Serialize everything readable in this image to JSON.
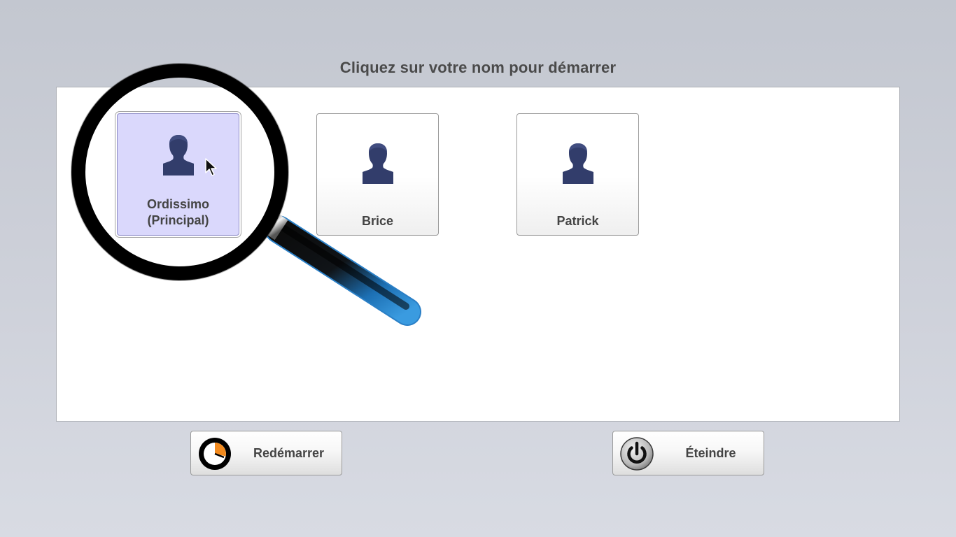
{
  "header": {
    "title": "Cliquez sur votre nom pour démarrer"
  },
  "users": [
    {
      "name_line1": "Ordissimo",
      "name_line2": "(Principal)",
      "selected": true
    },
    {
      "name": "Brice",
      "selected": false
    },
    {
      "name": "Patrick",
      "selected": false
    }
  ],
  "footer": {
    "restart_label": "Redémarrer",
    "shutdown_label": "Éteindre"
  },
  "colors": {
    "selected_card": "#dad8fc",
    "avatar": "#323d6b",
    "magnifier_handle": "#1c72b8",
    "restart_accent": "#f28a1e"
  },
  "icons": {
    "avatar": "user-silhouette-icon",
    "restart": "restart-icon",
    "shutdown": "power-icon",
    "magnifier": "magnifier-icon",
    "cursor": "mouse-cursor-icon"
  }
}
